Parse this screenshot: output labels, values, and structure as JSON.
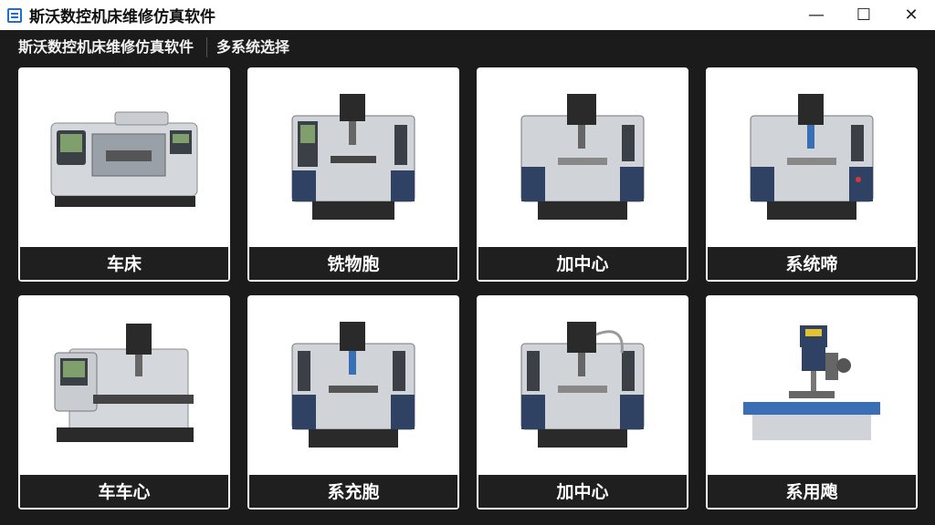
{
  "window": {
    "title": "斯沃数控机床维修仿真软件",
    "minimize": "—",
    "maximize": "☐",
    "close": "✕"
  },
  "menu": {
    "items": [
      {
        "label": "斯沃数控机床维修仿真软件"
      },
      {
        "label": "多系统选择"
      }
    ]
  },
  "cards": [
    {
      "label": "车床",
      "icon": "lathe-icon"
    },
    {
      "label": "铣物胞",
      "icon": "milling-machine-icon"
    },
    {
      "label": "加中心",
      "icon": "machining-center-icon"
    },
    {
      "label": "系统啼",
      "icon": "machining-center-icon"
    },
    {
      "label": "车车心",
      "icon": "turning-center-icon"
    },
    {
      "label": "系充胞",
      "icon": "milling-machine-icon"
    },
    {
      "label": "加中心",
      "icon": "machining-center-icon"
    },
    {
      "label": "系用飑",
      "icon": "drill-press-icon"
    }
  ],
  "colors": {
    "titlebar_bg": "#ffffff",
    "body_bg": "#1b1b1b",
    "card_bg": "#ffffff",
    "label_bg": "#1f1f1f",
    "machine_blue": "#2f4263",
    "machine_gray": "#c9ccd1",
    "machine_dark": "#2a2a2a"
  }
}
